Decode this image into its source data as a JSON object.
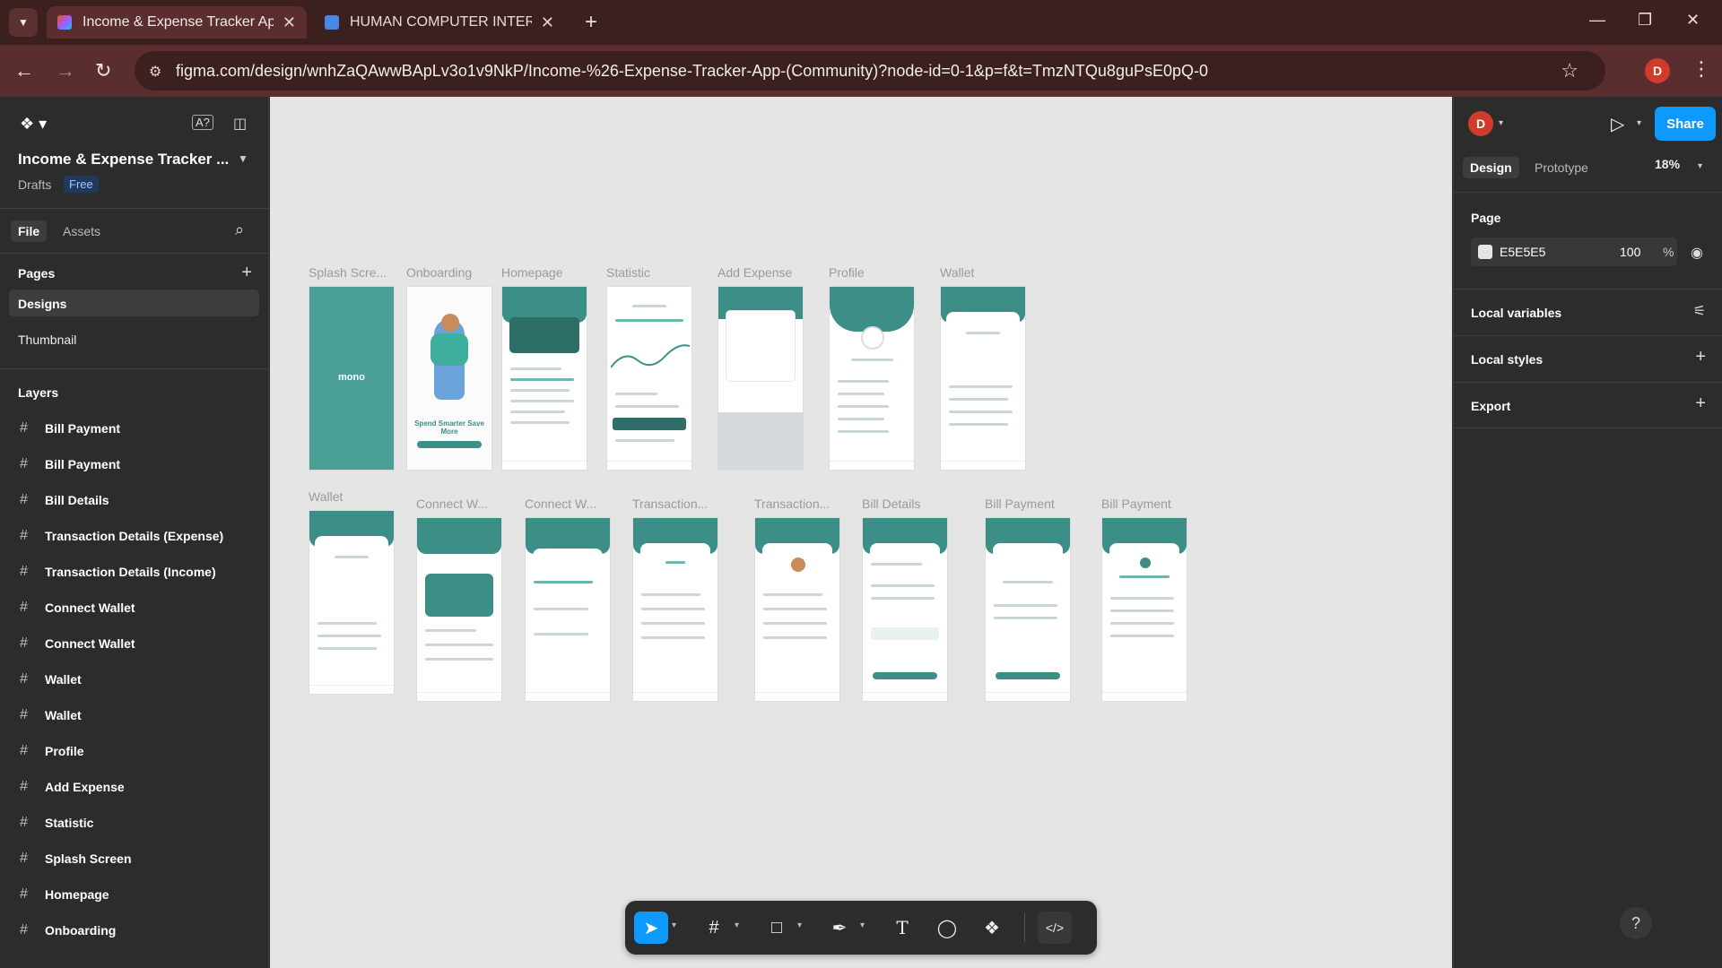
{
  "browser": {
    "tabs": [
      {
        "title": "Income & Expense Tracker App",
        "favicon": "figma-icon",
        "active": true
      },
      {
        "title": "HUMAN COMPUTER INTERACTI",
        "favicon": "docs-icon",
        "active": false
      }
    ],
    "url": "figma.com/design/wnhZaQAwwBApLv3o1v9NkP/Income-%26-Expense-Tracker-App-(Community)?node-id=0-1&p=f&t=TmzNTQu8guPsE0pQ-0",
    "profile_initial": "D"
  },
  "left_panel": {
    "project_title": "Income & Expense Tracker ...",
    "drafts_label": "Drafts",
    "plan_badge": "Free",
    "tabs": [
      "File",
      "Assets"
    ],
    "pages_heading": "Pages",
    "pages": [
      "Designs",
      "Thumbnail"
    ],
    "layers_heading": "Layers",
    "layers": [
      "Bill Payment",
      "Bill Payment",
      "Bill Details",
      "Transaction Details (Expense)",
      "Transaction Details (Income)",
      "Connect Wallet",
      "Connect Wallet",
      "Wallet",
      "Wallet",
      "Profile",
      "Add Expense",
      "Statistic",
      "Splash Screen",
      "Homepage",
      "Onboarding"
    ]
  },
  "canvas": {
    "background": "#E5E5E5",
    "row1_labels": [
      "Splash Scre...",
      "Onboarding",
      "Homepage",
      "Statistic",
      "Add Expense",
      "Profile",
      "Wallet"
    ],
    "row2_labels": [
      "Wallet",
      "Connect W...",
      "Connect W...",
      "Transaction...",
      "Transaction...",
      "Bill Details",
      "Bill Payment",
      "Bill Payment"
    ],
    "splash_text": "mono",
    "onboarding_text": "Spend Smarter Save More"
  },
  "right_panel": {
    "avatar_initial": "D",
    "share_label": "Share",
    "tabs": [
      "Design",
      "Prototype"
    ],
    "zoom": "18%",
    "page_heading": "Page",
    "page_color_hex": "E5E5E5",
    "page_opacity": "100",
    "percent_sign": "%",
    "local_variables": "Local variables",
    "local_styles": "Local styles",
    "export": "Export"
  },
  "colors": {
    "accent": "#0d99ff",
    "brand_teal": "#3c8f87",
    "chrome": "#5a2e2e"
  }
}
